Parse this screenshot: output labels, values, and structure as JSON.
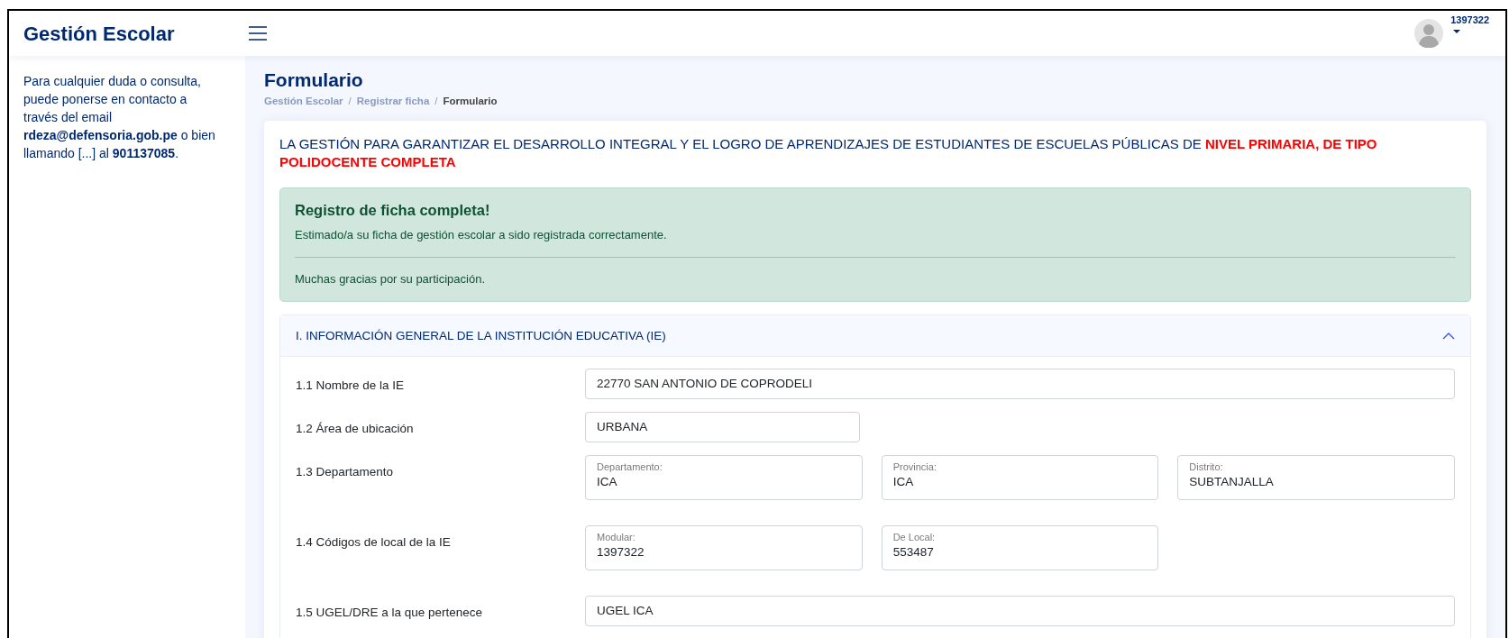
{
  "header": {
    "brand": "Gestión Escolar",
    "user": "1397322"
  },
  "sidebar": {
    "contact": "Para cualquier duda o consulta, puede ponerse en contacto a través del email **rdeza@defensoria.gob.pe** o bien llamando [...] al **901137085**."
  },
  "page": {
    "title": "Formulario",
    "breadcrumb": [
      {
        "kind": "link",
        "label": "Gestión Escolar"
      },
      {
        "kind": "separator",
        "label": "/"
      },
      {
        "kind": "link",
        "label": "Registrar ficha"
      },
      {
        "kind": "separator",
        "label": "/"
      },
      {
        "kind": "current",
        "label": "Formulario"
      }
    ]
  },
  "card": {
    "heading": "LA GESTIÓN PARA GARANTIZAR EL DESARROLLO INTEGRAL Y EL LOGRO DE APRENDIZAJES DE ESTUDIANTES DE ESCUELAS PÚBLICAS DE **NIVEL PRIMARIA, DE TIPO POLIDOCENTE COMPLETA**",
    "alert": {
      "title": "Registro de ficha completa!",
      "message": "Estimado/a su ficha de gestión escolar a sido registrada correctamente.",
      "footer": "Muchas gracias por su participación."
    },
    "section": {
      "title": "I. INFORMACIÓN GENERAL DE LA INSTITUCIÓN EDUCATIVA (IE)",
      "expanded": true,
      "rows": [
        {
          "kind": "full",
          "label": "1.1 Nombre de la IE",
          "fields": [
            {
              "value": "22770 SAN ANTONIO DE COPRODELI"
            }
          ]
        },
        {
          "kind": "short",
          "label": "1.2 Área de ubicación",
          "fields": [
            {
              "value": "URBANA"
            }
          ]
        },
        {
          "kind": "group",
          "label": "1.3 Departamento",
          "fields": [
            {
              "caption": "Departamento:",
              "value": "ICA"
            },
            {
              "caption": "Provincia:",
              "value": "ICA"
            },
            {
              "caption": "Distrito:",
              "value": "SUBTANJALLA"
            }
          ]
        },
        {
          "kind": "group",
          "label": "1.4 Códigos de local de la IE",
          "fields": [
            {
              "caption": "Modular:",
              "value": "1397322"
            },
            {
              "caption": "De Local:",
              "value": "553487"
            }
          ]
        },
        {
          "kind": "full",
          "label": "1.5 UGEL/DRE a la que pertenece",
          "fields": [
            {
              "value": "UGEL ICA"
            }
          ]
        }
      ]
    }
  }
}
